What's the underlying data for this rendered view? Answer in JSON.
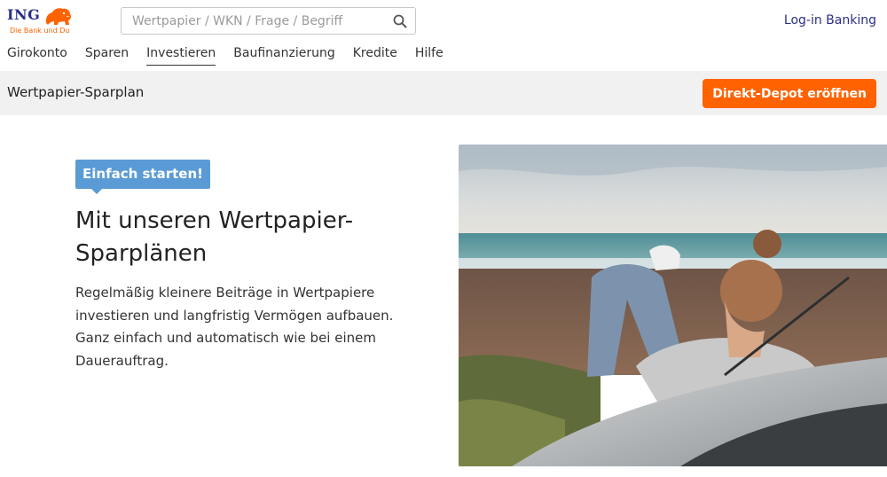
{
  "brand": {
    "name": "ING",
    "tagline": "Die Bank und Du",
    "logo_icon": "lion-icon",
    "color_blue": "#2a2f87",
    "color_orange": "#ff6200"
  },
  "search": {
    "placeholder": "Wertpapier / WKN / Frage / Begriff",
    "value": "",
    "icon": "search-icon"
  },
  "header": {
    "login_label": "Log-in Banking"
  },
  "nav": {
    "items": [
      {
        "label": "Girokonto"
      },
      {
        "label": "Sparen"
      },
      {
        "label": "Investieren",
        "active": true
      },
      {
        "label": "Baufinanzierung"
      },
      {
        "label": "Kredite"
      },
      {
        "label": "Hilfe"
      }
    ]
  },
  "subbar": {
    "title": "Wertpapier-Sparplan",
    "cta_label": "Direkt-Depot eröffnen"
  },
  "hero": {
    "tag": "Einfach starten!",
    "headline_line1": "Mit unseren Wertpapier-",
    "headline_line2": "Sparplänen",
    "description": "Regelmäßig kleinere Beiträge in Wertpapiere investieren und langfristig Vermögen aufbauen. Ganz einfach und automatisch wie bei einem Dauerauftrag.",
    "tag_color": "#5b9bd5"
  }
}
